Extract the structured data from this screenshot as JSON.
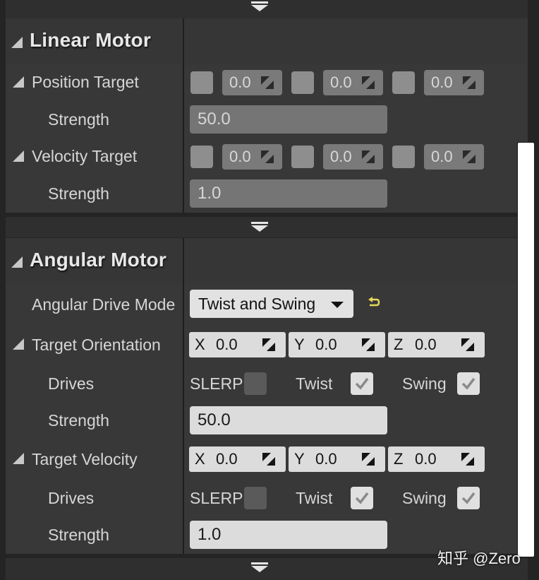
{
  "linear_motor": {
    "title": "Linear Motor",
    "position_target": {
      "label": "Position Target",
      "values": [
        "0.0",
        "0.0",
        "0.0"
      ],
      "strength_label": "Strength",
      "strength": "50.0"
    },
    "velocity_target": {
      "label": "Velocity Target",
      "values": [
        "0.0",
        "0.0",
        "0.0"
      ],
      "strength_label": "Strength",
      "strength": "1.0"
    }
  },
  "angular_motor": {
    "title": "Angular Motor",
    "drive_mode": {
      "label": "Angular Drive Mode",
      "value": "Twist and Swing"
    },
    "target_orientation": {
      "label": "Target Orientation",
      "x_label": "X",
      "x": "0.0",
      "y_label": "Y",
      "y": "0.0",
      "z_label": "Z",
      "z": "0.0",
      "drives_label": "Drives",
      "slerp_label": "SLERP",
      "slerp": false,
      "twist_label": "Twist",
      "twist": true,
      "swing_label": "Swing",
      "swing": true,
      "strength_label": "Strength",
      "strength": "50.0"
    },
    "target_velocity": {
      "label": "Target Velocity",
      "x_label": "X",
      "x": "0.0",
      "y_label": "Y",
      "y": "0.0",
      "z_label": "Z",
      "z": "0.0",
      "drives_label": "Drives",
      "slerp_label": "SLERP",
      "slerp": false,
      "twist_label": "Twist",
      "twist": true,
      "swing_label": "Swing",
      "swing": true,
      "strength_label": "Strength",
      "strength": "1.0"
    }
  },
  "watermark": "知乎 @Zero",
  "colors": {
    "panel_bg": "#242424",
    "row_bg": "#383838",
    "header_bg": "#363636",
    "field_enabled": "#dcdcdc",
    "field_disabled": "#757575",
    "reset_arrow": "#e8d85a"
  }
}
